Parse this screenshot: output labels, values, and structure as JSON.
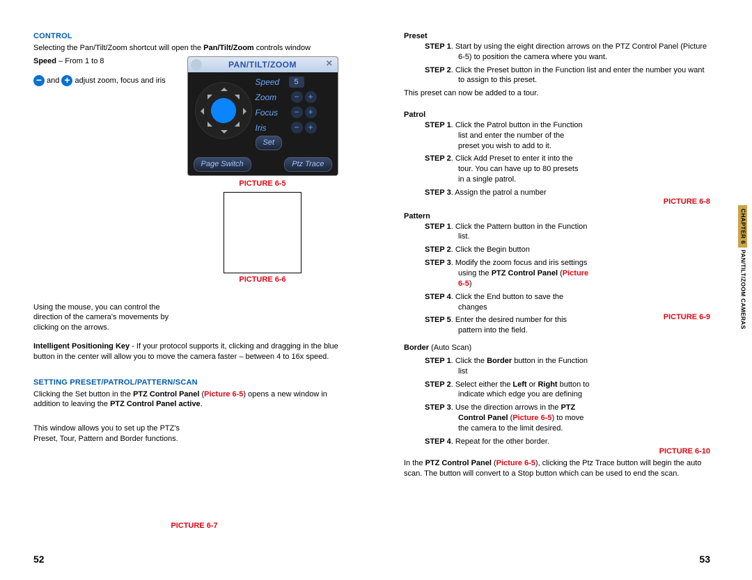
{
  "left_page": {
    "heading_control": "CONTROL",
    "control_intro_pre": "Selecting the Pan/Tilt/Zoom shortcut will open the ",
    "control_intro_bold": "Pan/Tilt/Zoom",
    "control_intro_post": " controls window",
    "speed_label": "Speed",
    "speed_range": " – From 1 to 8",
    "minus_label": "−",
    "plus_label": "+",
    "zoom_and": " and ",
    "zoom_line_end": " adjust zoom, focus and iris",
    "panel": {
      "title": "PAN/TILT/ZOOM",
      "rows": {
        "speed": "Speed",
        "speed_val": "5",
        "zoom": "Zoom",
        "focus": "Focus",
        "iris": "Iris",
        "set": "Set",
        "page_switch": "Page Switch",
        "ptz_trace": "Ptz Trace"
      }
    },
    "pic65": "PICTURE 6-5",
    "mouse_text": "Using the mouse, you can control the direction of the camera's movements by clicking on the arrows.",
    "pic66": "PICTURE 6-6",
    "ipk_bold": "Intelligent Positioning Key",
    "ipk_text": " - If your protocol supports it, clicking and dragging in the blue button in the center will allow you to move the camera faster – between 4 to 16x speed.",
    "heading_setting": "SETTING PRESET/PATROL/PATTERN/SCAN",
    "setting_p_pre": "Clicking the Set button in the ",
    "setting_p_b1": "PTZ Control Panel",
    "setting_p_paren_open": " (",
    "setting_p_red": "Picture 6-5",
    "setting_p_paren_close": ") opens a new window in addition to leaving the ",
    "setting_p_b2": "PTZ Control Panel active",
    "setting_p_end": ".",
    "window_text": "This window allows you to set up the PTZ's Preset, Tour, Pattern and Border functions.",
    "pic67": "PICTURE 6-7",
    "page_num": "52"
  },
  "right_page": {
    "preset_heading": "Preset",
    "preset_s1_pre": "STEP 1",
    "preset_s1": ". Start by using the eight direction arrows on the PTZ Control Panel (Picture 6-5) to position the camera where you want.",
    "preset_s2_pre": "STEP 2",
    "preset_s2": ". Click the Preset button in the Function list and enter the number you want to assign to this preset.",
    "preset_footer": "This preset can now be added to a tour.",
    "patrol_heading": "Patrol",
    "patrol_s1_pre": "STEP 1",
    "patrol_s1": ". Click the Patrol button in the Function list and enter the number of the preset you wish to add to it.",
    "patrol_s2_pre": "STEP 2",
    "patrol_s2": ". Click Add Preset to enter it into the tour. You can have up to 80 presets in a single patrol.",
    "patrol_s3_pre": "STEP 3",
    "patrol_s3": ". Assign the patrol a number",
    "pic68": "PICTURE 6-8",
    "pattern_heading": "Pattern",
    "pattern_s1_pre": "STEP 1",
    "pattern_s1": ". Click the Pattern button in the Function list.",
    "pattern_s2_pre": "STEP 2",
    "pattern_s2": ". Click the Begin button",
    "pattern_s3_pre": "STEP 3",
    "pattern_s3_a": ". Modify the zoom focus and iris settings using the ",
    "pattern_s3_bold": "PTZ Control Panel",
    "pattern_s3_paren_open": " (",
    "pattern_s3_red": "Picture 6-5",
    "pattern_s3_paren_close": ")",
    "pattern_s4_pre": "STEP 4",
    "pattern_s4": ". Click the End button to save the changes",
    "pattern_s5_pre": "STEP 5",
    "pattern_s5": ". Enter the desired number for this pattern into the field.",
    "pic69": "PICTURE 6-9",
    "border_heading": "Border",
    "border_sub": " (Auto Scan)",
    "border_s1_pre": "STEP 1",
    "border_s1_a": ". Click the ",
    "border_s1_bold": "Border",
    "border_s1_b": " button in the Function list",
    "border_s2_pre": "STEP 2",
    "border_s2_a": ". Select either the ",
    "border_s2_left": "Left",
    "border_s2_or": " or ",
    "border_s2_right": "Right",
    "border_s2_b": " button to indicate which edge you are defining",
    "border_s3_pre": "STEP 3",
    "border_s3_a": ". Use the direction arrows in the ",
    "border_s3_bold": "PTZ Control Panel",
    "border_s3_paren_open": " (",
    "border_s3_red": "Picture 6-5",
    "border_s3_paren_close": ") to move the camera to the limit desired.",
    "border_s4_pre": "STEP 4",
    "border_s4": ". Repeat for the other border.",
    "pic610": "PICTURE 6-10",
    "scan_intro_pre": "In the ",
    "scan_intro_bold": "PTZ Control Panel",
    "scan_intro_paren_open": " (",
    "scan_intro_red": "Picture 6-5",
    "scan_intro_paren_close": "), clicking the Ptz Trace button will begin the auto scan. The button will convert to a Stop button which can be used to end the scan.",
    "page_num": "53",
    "tab_chapter": "CHAPTER 6",
    "tab_title": "PAN/TILT/ZOOM CAMERAS"
  }
}
